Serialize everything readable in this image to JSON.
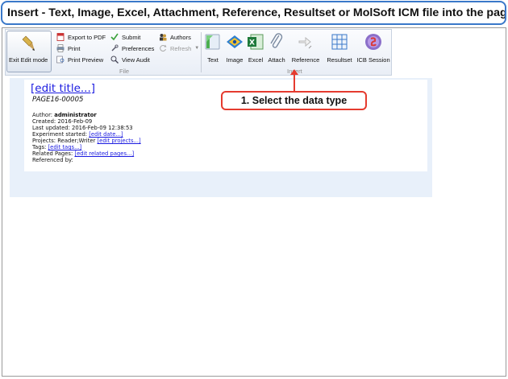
{
  "banner": {
    "text": "Insert - Text, Image, Excel, Attachment, Reference, Resultset or MolSoft ICM file into the page."
  },
  "toolbar": {
    "exit_edit_mode": "Exit Edit mode",
    "file_group": {
      "label": "File",
      "items": {
        "export_pdf": "Export to PDF",
        "print": "Print",
        "print_preview": "Print Preview",
        "submit": "Submit",
        "preferences": "Preferences",
        "view_audit": "View Audit",
        "authors": "Authors",
        "refresh": "Refresh"
      }
    },
    "insert_group": {
      "label": "Insert",
      "buttons": {
        "text": "Text",
        "image": "Image",
        "excel": "Excel",
        "attach": "Attach",
        "reference": "Reference",
        "resultset": "Resultset",
        "icb_session": "ICB Session"
      }
    }
  },
  "page": {
    "edit_title": "[edit title...]",
    "page_id": "PAGE16-00005",
    "author_label": "Author:",
    "author_value": "administrator",
    "created": "Created: 2016-Feb-09",
    "last_updated": "Last updated: 2016-Feb-09 12:38:53",
    "experiment_label": "Experiment started:",
    "experiment_link": "[edit date...]",
    "projects_label": "Projects: Reader;Writer",
    "projects_link": "[edit projects...]",
    "tags_label": "Tags:",
    "tags_link": "[edit tags...]",
    "related_label": "Related Pages:",
    "related_link": "[edit related pages...]",
    "referenced_by": "Referenced by:"
  },
  "callout": {
    "text": "1. Select the data type",
    "color": "#e53b2f"
  },
  "colors": {
    "banner_border": "#3a78c9",
    "link": "#1a1ae0",
    "page_bg": "#e8f0fa"
  }
}
